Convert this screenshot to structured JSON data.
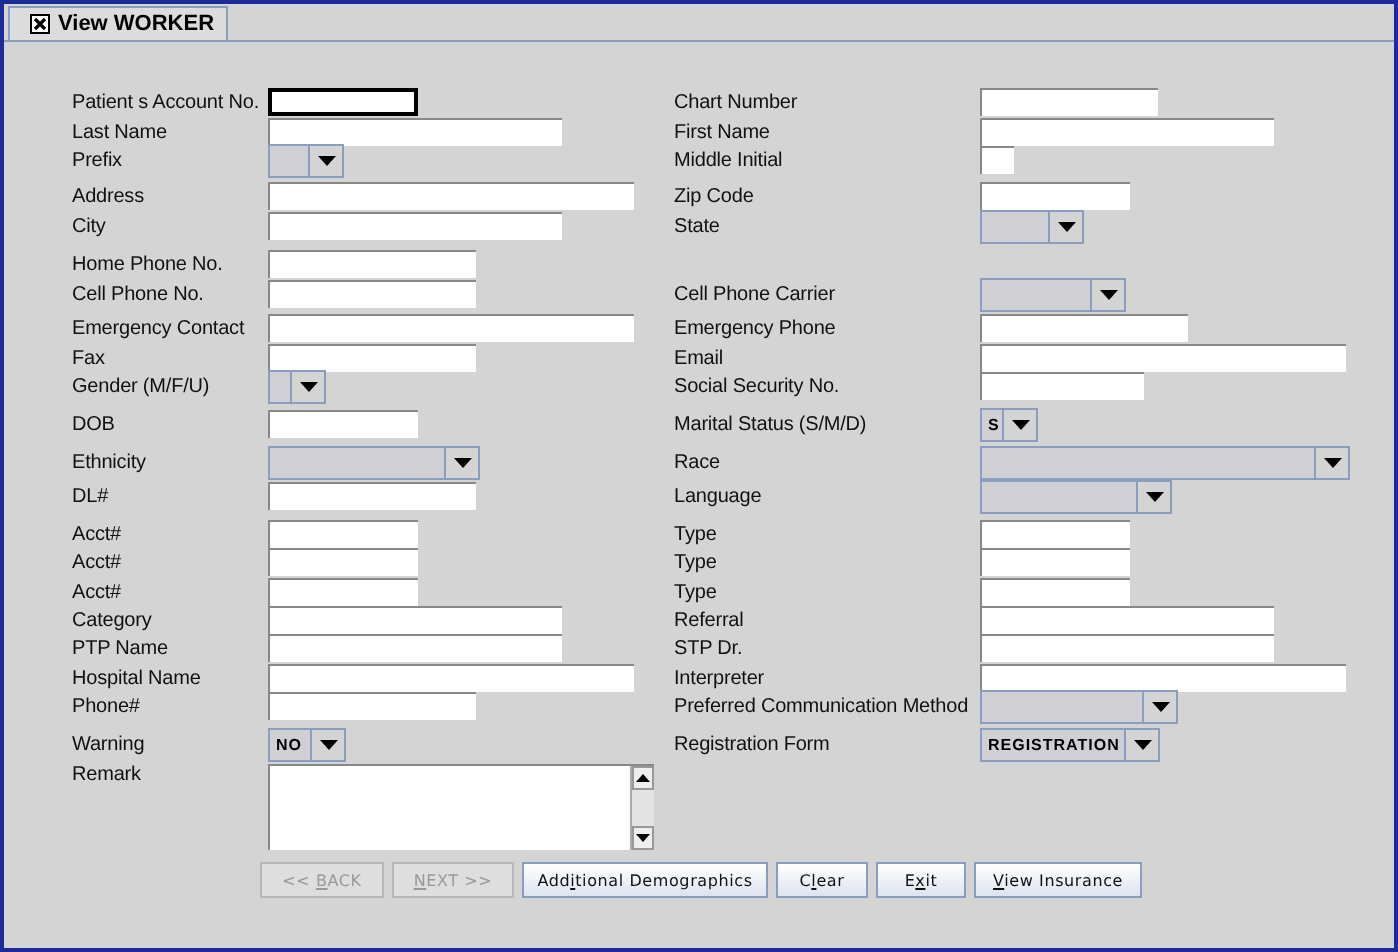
{
  "tab": {
    "title": "View WORKER"
  },
  "rows": [
    {
      "left": {
        "label": "Patient s Account No.",
        "field": {
          "kind": "text",
          "focused": true
        }
      },
      "right": {
        "label": "Chart Number",
        "field": {
          "kind": "text"
        }
      }
    },
    {
      "left": {
        "label": "Last Name",
        "field": {
          "kind": "text"
        }
      },
      "right": {
        "label": "First Name",
        "field": {
          "kind": "text"
        }
      }
    },
    {
      "left": {
        "label": "Prefix",
        "field": {
          "kind": "combo"
        }
      },
      "right": {
        "label": "Middle Initial",
        "field": {
          "kind": "text"
        }
      }
    },
    {
      "left": {
        "label": "Address",
        "field": {
          "kind": "text"
        }
      },
      "right": {
        "label": "Zip Code",
        "field": {
          "kind": "text"
        }
      }
    },
    {
      "left": {
        "label": "City",
        "field": {
          "kind": "text"
        }
      },
      "right": {
        "label": "State",
        "field": {
          "kind": "combo"
        }
      }
    },
    {
      "left": {
        "label": "Home Phone No.",
        "field": {
          "kind": "text"
        }
      }
    },
    {
      "left": {
        "label": "Cell Phone No.",
        "field": {
          "kind": "text"
        }
      },
      "right": {
        "label": "Cell Phone Carrier",
        "field": {
          "kind": "combo"
        }
      }
    },
    {
      "left": {
        "label": "Emergency Contact",
        "field": {
          "kind": "text"
        }
      },
      "right": {
        "label": "Emergency Phone",
        "field": {
          "kind": "text"
        }
      }
    },
    {
      "left": {
        "label": "Fax",
        "field": {
          "kind": "text"
        }
      },
      "right": {
        "label": "Email",
        "field": {
          "kind": "text"
        }
      }
    },
    {
      "left": {
        "label": "Gender (M/F/U)",
        "field": {
          "kind": "combo"
        }
      },
      "right": {
        "label": "Social Security No.",
        "field": {
          "kind": "text"
        }
      }
    },
    {
      "left": {
        "label": "DOB",
        "field": {
          "kind": "text"
        }
      },
      "right": {
        "label": "Marital Status (S/M/D)",
        "field": {
          "kind": "combo",
          "value": "S"
        }
      }
    },
    {
      "left": {
        "label": "Ethnicity",
        "field": {
          "kind": "combo"
        }
      },
      "right": {
        "label": "Race",
        "field": {
          "kind": "combo"
        }
      }
    },
    {
      "left": {
        "label": "DL#",
        "field": {
          "kind": "text"
        }
      },
      "right": {
        "label": "Language",
        "field": {
          "kind": "combo"
        }
      }
    },
    {
      "left": {
        "label": "Acct#",
        "field": {
          "kind": "text"
        }
      },
      "right": {
        "label": "Type",
        "field": {
          "kind": "text"
        }
      }
    },
    {
      "left": {
        "label": "Acct#",
        "field": {
          "kind": "text"
        }
      },
      "right": {
        "label": "Type",
        "field": {
          "kind": "text"
        }
      }
    },
    {
      "left": {
        "label": "Acct#",
        "field": {
          "kind": "text"
        }
      },
      "right": {
        "label": "Type",
        "field": {
          "kind": "text"
        }
      }
    },
    {
      "left": {
        "label": "Category",
        "field": {
          "kind": "text"
        }
      },
      "right": {
        "label": "Referral",
        "field": {
          "kind": "text"
        }
      }
    },
    {
      "left": {
        "label": "PTP Name",
        "field": {
          "kind": "text"
        }
      },
      "right": {
        "label": "STP Dr.",
        "field": {
          "kind": "text"
        }
      }
    },
    {
      "left": {
        "label": "Hospital Name",
        "field": {
          "kind": "text"
        }
      },
      "right": {
        "label": "Interpreter",
        "field": {
          "kind": "text"
        }
      }
    },
    {
      "left": {
        "label": "Phone#",
        "field": {
          "kind": "text"
        }
      },
      "right": {
        "label": "Preferred Communication Method",
        "field": {
          "kind": "combo"
        }
      }
    },
    {
      "left": {
        "label": "Warning",
        "field": {
          "kind": "combo",
          "value": "NO"
        }
      },
      "right": {
        "label": "Registration Form",
        "field": {
          "kind": "combo",
          "value": "REGISTRATION"
        }
      }
    },
    {
      "left": {
        "label": "Remark",
        "field": {
          "kind": "textarea"
        }
      }
    }
  ],
  "buttons": [
    {
      "label_start": "<< ",
      "mnemonic_key": "B",
      "label_end": "ACK",
      "disabled": true
    },
    {
      "mnemonic_key": "N",
      "label_end": "EXT >>",
      "disabled": true
    },
    {
      "label_start": "Add",
      "mnemonic_key": "i",
      "label_end": "tional Demographics",
      "disabled": false
    },
    {
      "label_start": "C",
      "mnemonic_key": "l",
      "label_end": "ear",
      "disabled": false
    },
    {
      "label_start": "E",
      "mnemonic_key": "x",
      "label_end": "it",
      "disabled": false
    },
    {
      "mnemonic_key": "V",
      "label_end": "iew Insurance",
      "disabled": false
    }
  ]
}
